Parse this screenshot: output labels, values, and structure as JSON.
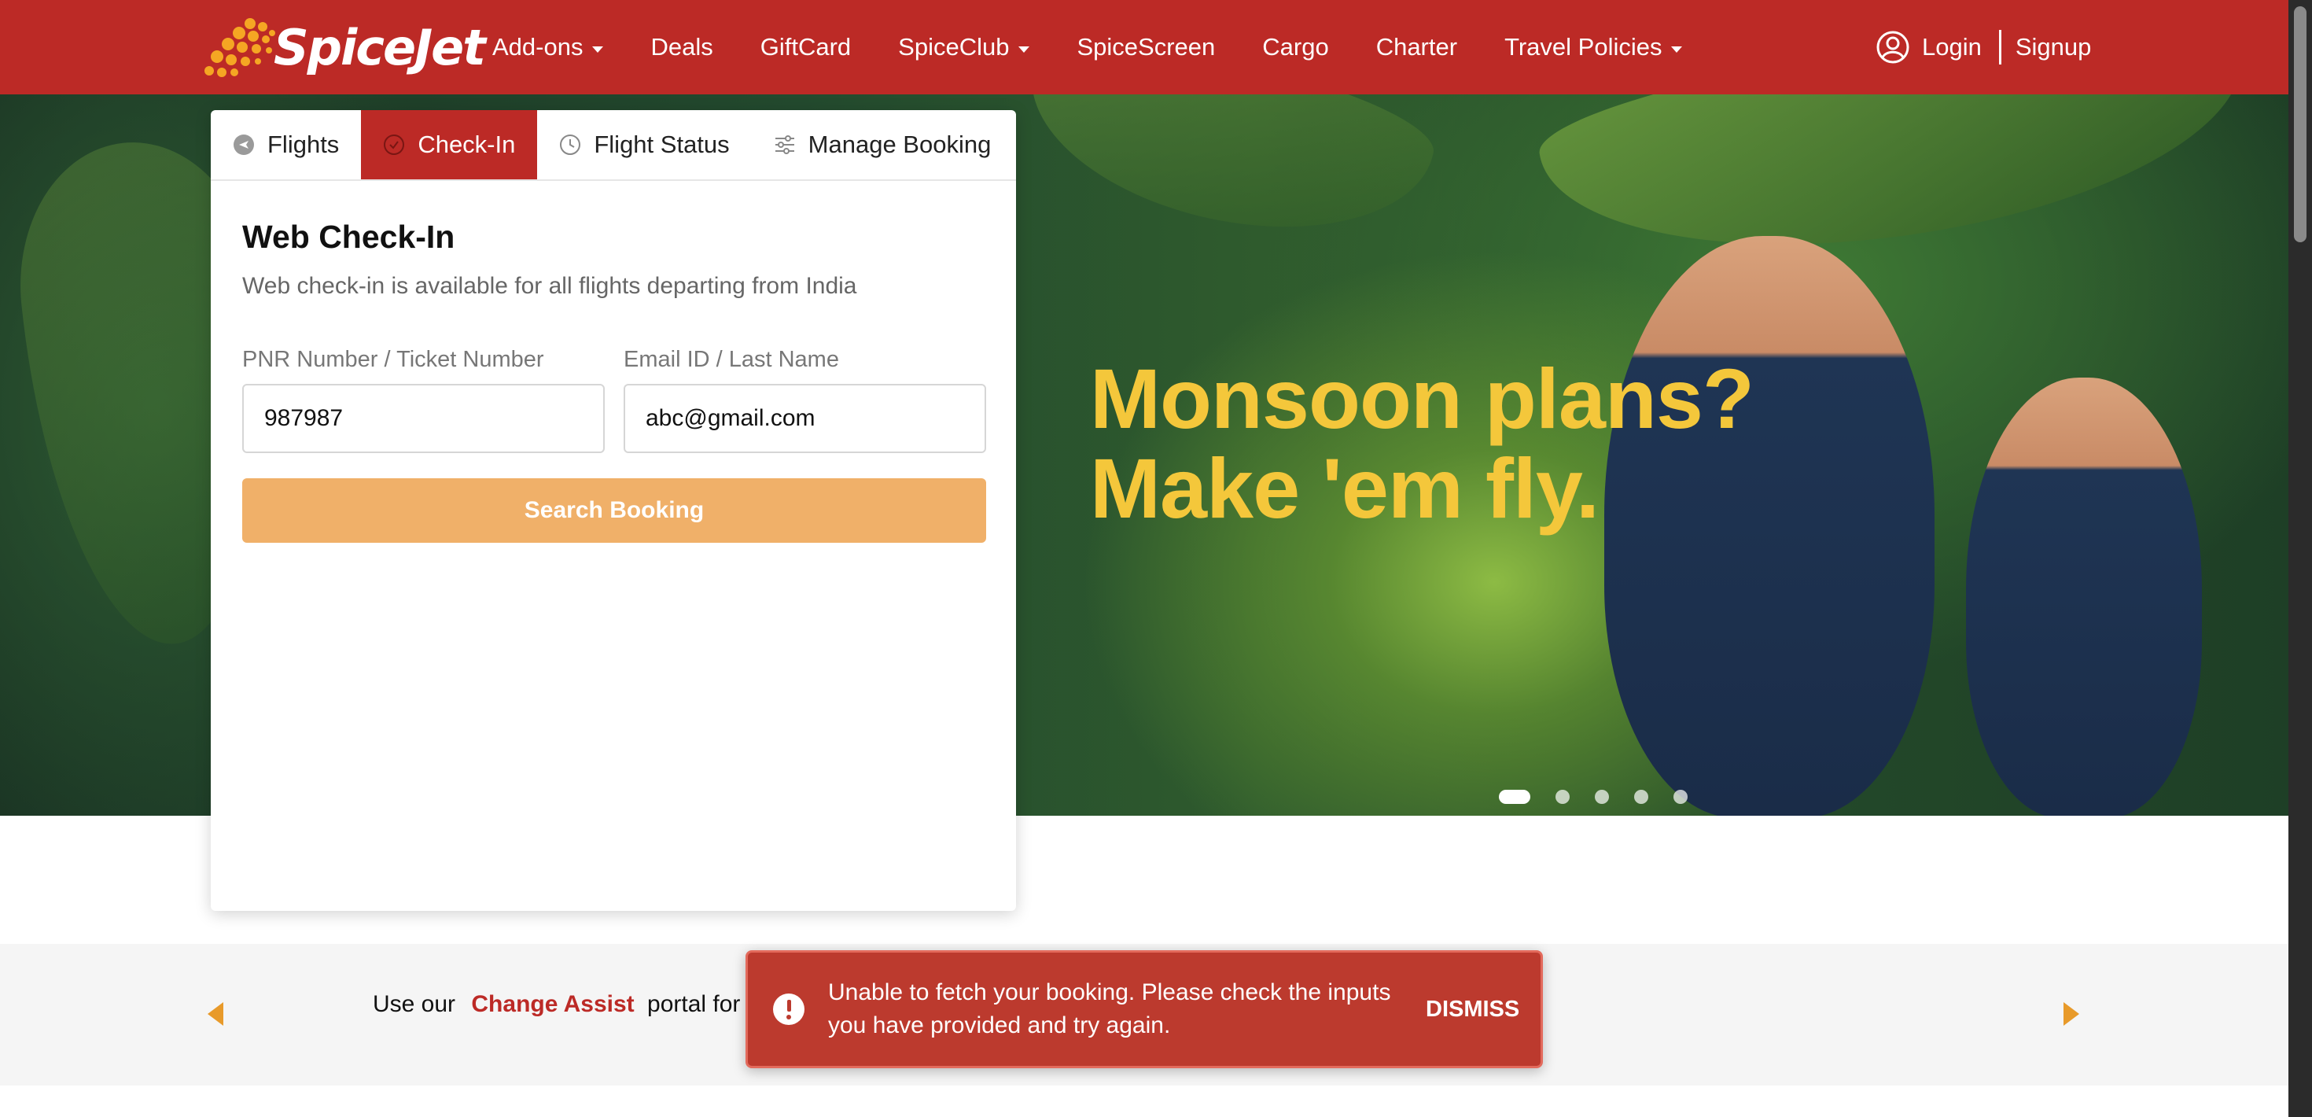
{
  "brand": {
    "name": "SpiceJet"
  },
  "nav": {
    "items": [
      {
        "label": "Add-ons",
        "dropdown": true
      },
      {
        "label": "Deals",
        "dropdown": false
      },
      {
        "label": "GiftCard",
        "dropdown": false
      },
      {
        "label": "SpiceClub",
        "dropdown": true
      },
      {
        "label": "SpiceScreen",
        "dropdown": false
      },
      {
        "label": "Cargo",
        "dropdown": false
      },
      {
        "label": "Charter",
        "dropdown": false
      },
      {
        "label": "Travel Policies",
        "dropdown": true
      }
    ],
    "login": "Login",
    "signup": "Signup"
  },
  "widget": {
    "tabs": [
      {
        "label": "Flights",
        "icon": "plane-icon",
        "active": false
      },
      {
        "label": "Check-In",
        "icon": "checkin-icon",
        "active": true
      },
      {
        "label": "Flight Status",
        "icon": "clock-icon",
        "active": false
      },
      {
        "label": "Manage Booking",
        "icon": "sliders-icon",
        "active": false
      }
    ],
    "title": "Web Check-In",
    "subtitle": "Web check-in is available for all flights departing from India",
    "pnr_label": "PNR Number / Ticket Number",
    "pnr_value": "987987",
    "email_label": "Email ID / Last Name",
    "email_value": "abc@gmail.com",
    "search_button": "Search Booking"
  },
  "hero": {
    "headline_line1": "Monsoon plans?",
    "headline_line2": "Make 'em fly.",
    "slide_count": 5,
    "active_slide": 1
  },
  "info_strip": {
    "prefix": "Use our",
    "link": "Change Assist",
    "suffix": "portal for e"
  },
  "toast": {
    "message": "Unable to fetch your booking. Please check the inputs you have provided and try again.",
    "dismiss": "DISMISS"
  },
  "colors": {
    "brand_red": "#bc2a26",
    "accent_orange": "#f0b069",
    "headline_yellow": "#f4c73b"
  }
}
